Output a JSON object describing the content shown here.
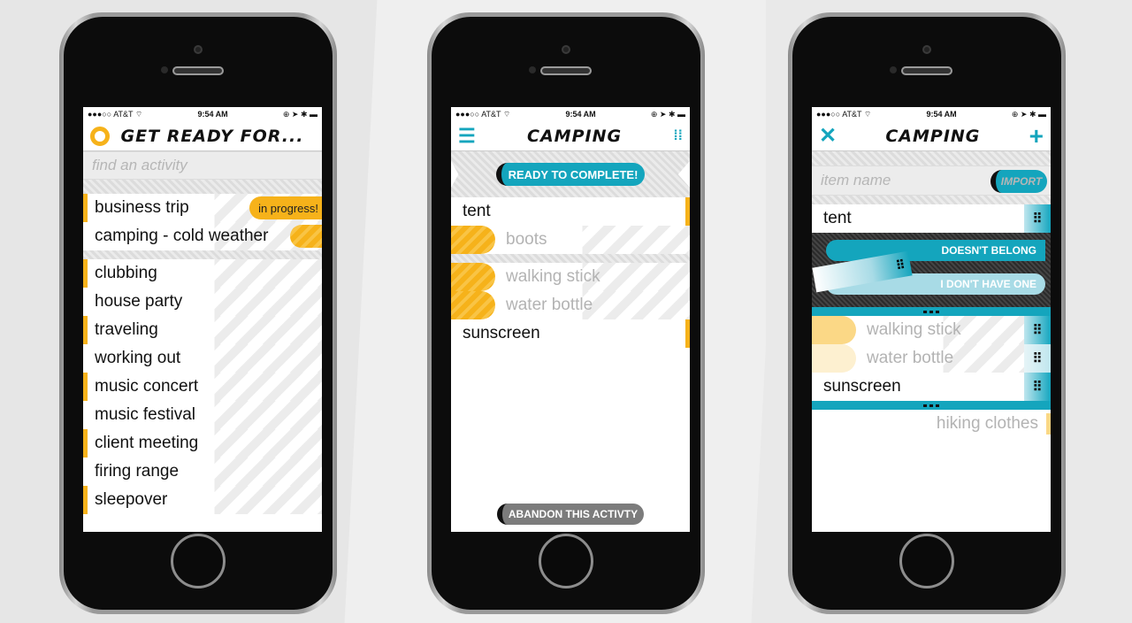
{
  "colors": {
    "accent_orange": "#f6b21a",
    "accent_teal": "#14a5bd"
  },
  "status": {
    "carrier": "AT&T",
    "time": "9:54 AM"
  },
  "screen1": {
    "title": "GET READY FOR...",
    "search_placeholder": "find an activity",
    "in_progress": [
      "business trip",
      "camping - cold weather"
    ],
    "in_progress_badge": "in progress!",
    "activities": [
      "clubbing",
      "house party",
      "traveling",
      "working out",
      "music concert",
      "music festival",
      "client meeting",
      "firing range",
      "sleepover"
    ]
  },
  "screen2": {
    "title": "CAMPING",
    "ready_label": "READY TO COMPLETE!",
    "items_a": [
      "tent"
    ],
    "done_a": [
      "boots"
    ],
    "done_b": [
      "walking stick",
      "water bottle"
    ],
    "items_b": [
      "sunscreen"
    ],
    "abandon_label": "ABANDON THIS ACTIVTY"
  },
  "screen3": {
    "title": "CAMPING",
    "item_placeholder": "item name",
    "import_label": "IMPORT",
    "items_a": [
      "tent"
    ],
    "doesnt_belong": "DOESN'T BELONG",
    "dont_have": "I DON'T HAVE ONE",
    "items_done": [
      "walking stick",
      "water bottle"
    ],
    "items_b": [
      "sunscreen"
    ],
    "extra": "hiking clothes"
  }
}
